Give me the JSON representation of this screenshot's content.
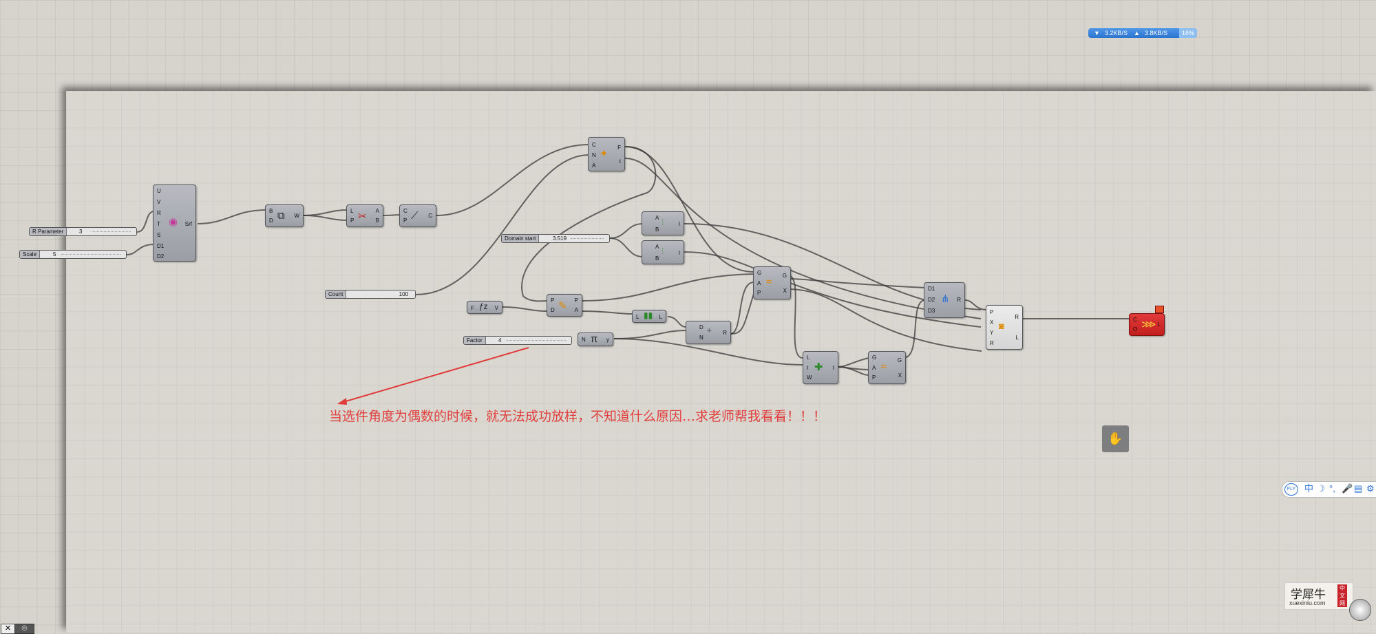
{
  "network_speed": {
    "download": "3.2KB/S",
    "upload": "3.8KB/S",
    "percent": "16%"
  },
  "annotation_text": "当选件角度为偶数的时候，就无法成功放样，不知道什么原因…求老师帮我看看！！！",
  "sliders": {
    "r_parameter": {
      "label": "R Parameter",
      "value": "3"
    },
    "scale": {
      "label": "Scale",
      "value": "5"
    },
    "domain_start": {
      "label": "Domain start",
      "value": "3.519"
    },
    "count": {
      "label": "Count",
      "value": "100"
    },
    "factor": {
      "label": "Factor",
      "value": "4"
    }
  },
  "components": {
    "surface": {
      "inputs": [
        "U",
        "V",
        "R",
        "T",
        "S",
        "D1",
        "D2"
      ],
      "outputs": [
        "Srf"
      ]
    },
    "weave": {
      "inputs": [
        "B",
        "D"
      ],
      "outputs": [
        "W"
      ]
    },
    "explode": {
      "inputs": [
        "L",
        "P"
      ],
      "outputs": [
        "A",
        "B"
      ]
    },
    "crv": {
      "inputs": [
        "C",
        "P"
      ],
      "outputs": [
        "C"
      ]
    },
    "divide": {
      "inputs": [
        "C",
        "N",
        "A"
      ],
      "outputs": [
        "F",
        "t"
      ]
    },
    "eval1": {
      "inputs": [
        "A",
        "B"
      ],
      "outputs": [
        "I"
      ]
    },
    "eval2": {
      "inputs": [
        "A",
        "B"
      ],
      "outputs": [
        "I"
      ]
    },
    "expr": {
      "inputs": [
        "F"
      ],
      "outputs": [
        "V"
      ]
    },
    "rotate": {
      "inputs": [
        "P",
        "D"
      ],
      "outputs": [
        "P",
        "A"
      ]
    },
    "series": {
      "inputs": [
        "L"
      ],
      "outputs": [
        "L"
      ]
    },
    "pi": {
      "inputs": [
        "N"
      ],
      "outputs": [
        "y"
      ],
      "symbol": "π"
    },
    "dispatch": {
      "inputs": [
        "D",
        "N"
      ],
      "outputs": [
        "R"
      ]
    },
    "graft1": {
      "inputs": [
        "G",
        "A",
        "P"
      ],
      "outputs": [
        "G",
        "X"
      ]
    },
    "insert": {
      "inputs": [
        "L",
        "I",
        "W"
      ],
      "outputs": [
        "I"
      ]
    },
    "graft2": {
      "inputs": [
        "G",
        "A",
        "P"
      ],
      "outputs": [
        "G",
        "X"
      ]
    },
    "merge": {
      "inputs": [
        "D1",
        "D2",
        "D3"
      ],
      "outputs": [
        "R"
      ]
    },
    "loft": {
      "inputs": [
        "P",
        "X",
        "Y",
        "R"
      ],
      "outputs": [
        "R",
        "L"
      ]
    },
    "sweep": {
      "inputs": [
        "C",
        "O"
      ],
      "outputs": [
        "L"
      ]
    }
  },
  "ime_toolbar": {
    "brand": "FLY",
    "items": [
      "中",
      "☽",
      "°,",
      "🎤",
      "▤",
      "⚙"
    ]
  },
  "watermark": {
    "title": "学犀牛",
    "site": "xuexiniu.com",
    "badge": "中文网"
  },
  "corner_icons": [
    "close-icon",
    "rhino-icon"
  ],
  "colors": {
    "canvas": "#d6d4cc",
    "component": "#a9abb2",
    "error_component": "#d42a2a",
    "annotation": "#e0403e",
    "net_bar": "#3b84dc"
  }
}
